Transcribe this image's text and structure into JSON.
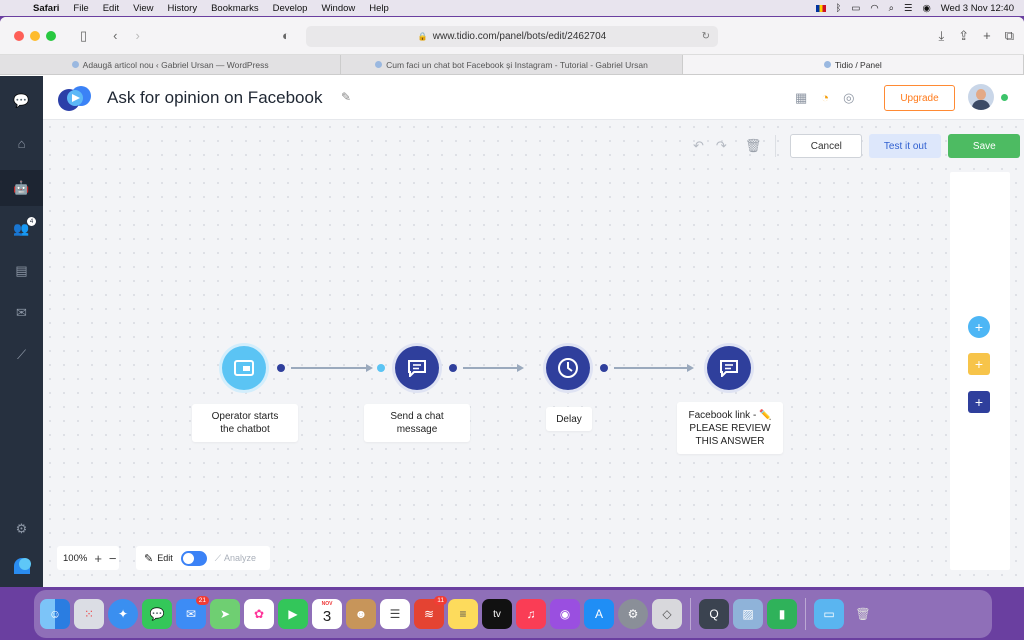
{
  "menubar": {
    "app": "Safari",
    "items": [
      "File",
      "Edit",
      "View",
      "History",
      "Bookmarks",
      "Develop",
      "Window",
      "Help"
    ],
    "clock": "Wed 3 Nov  12:40"
  },
  "browser": {
    "url": "www.tidio.com/panel/bots/edit/2462704",
    "tabs": [
      {
        "label": "Adaugă articol nou ‹ Gabriel Ursan — WordPress",
        "active": false
      },
      {
        "label": "Cum faci un chat bot Facebook și Instagram - Tutorial - Gabriel Ursan",
        "active": false
      },
      {
        "label": "Tidio / Panel",
        "active": true
      }
    ]
  },
  "header": {
    "title": "Ask for opinion on Facebook",
    "upgrade_label": "Upgrade"
  },
  "sidebar": {
    "badge": "4"
  },
  "actions": {
    "cancel_label": "Cancel",
    "test_label": "Test it out",
    "save_label": "Save"
  },
  "flow": {
    "nodes": [
      {
        "label": "Operator starts the chatbot",
        "icon": "window-icon",
        "color": "#5bc4f4"
      },
      {
        "label": "Send a chat message",
        "icon": "message-icon",
        "color": "#2f3f9c"
      },
      {
        "label": "Delay",
        "icon": "clock-icon",
        "color": "#2f3f9c"
      },
      {
        "label": "Facebook link - ✏️ PLEASE REVIEW THIS ANSWER",
        "icon": "message-icon",
        "color": "#2f3f9c"
      }
    ]
  },
  "canvas_controls": {
    "zoom": "100%",
    "edit_label": "Edit",
    "analyze_label": "Analyze"
  },
  "dock": {
    "mail_badge": "21",
    "todoist_badge": "11",
    "calendar_month": "NOV",
    "calendar_day": "3"
  },
  "colors": {
    "accent_blue": "#2f3f9c",
    "trigger_blue": "#5bc4f4",
    "save_green": "#4dbb62",
    "upgrade_orange": "#ff7a1a"
  }
}
